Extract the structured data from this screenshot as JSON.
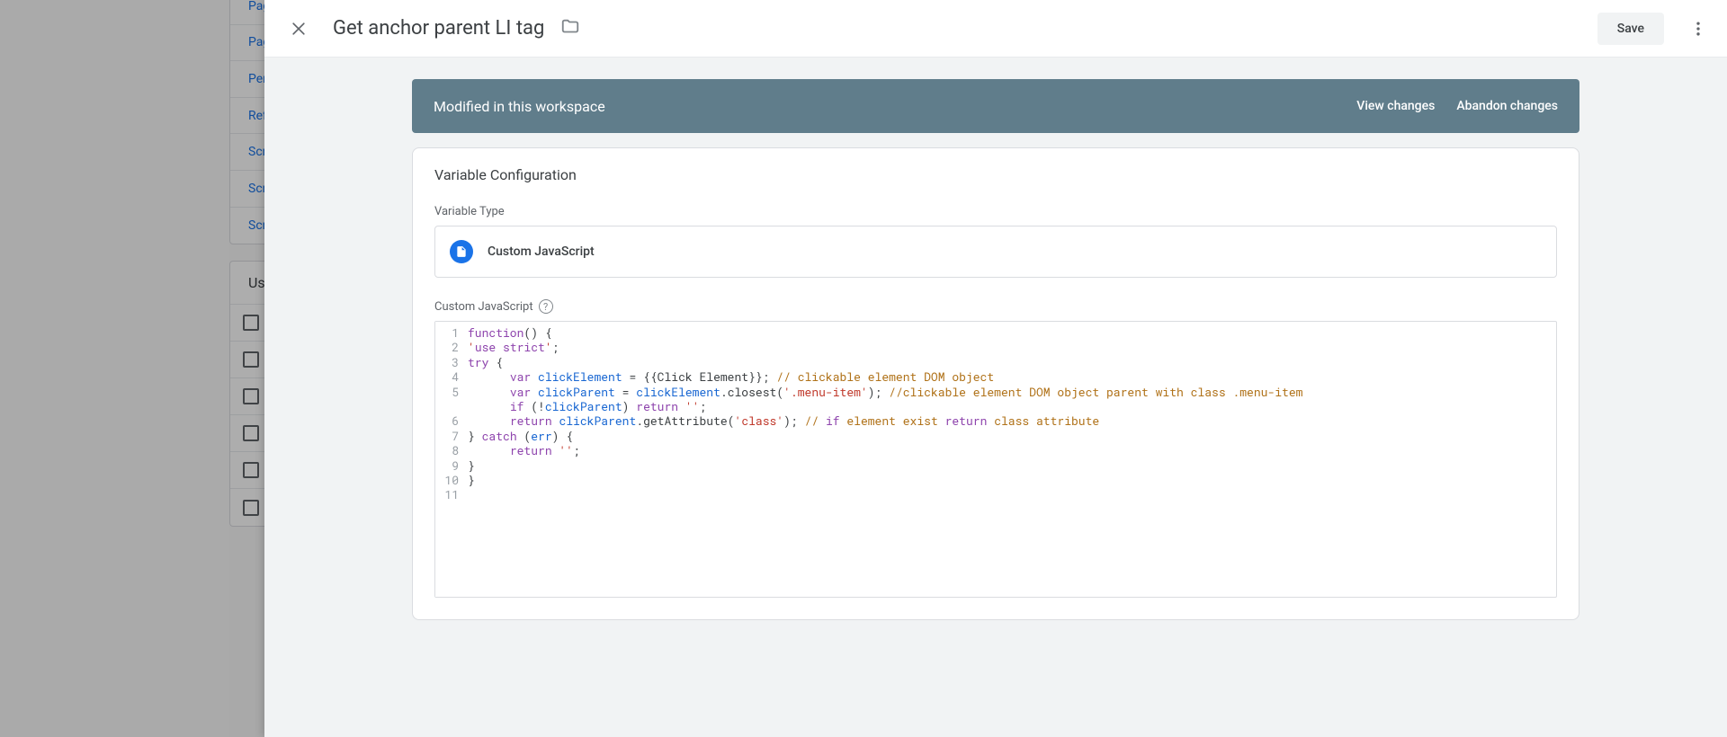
{
  "background": {
    "list_items": [
      "Pag",
      "Pag",
      "Per",
      "Ref",
      "Scr",
      "Scr",
      "Scr"
    ],
    "user_panel_header": "Us"
  },
  "editor_header": {
    "title": "Get anchor parent LI tag",
    "save_label": "Save"
  },
  "banner": {
    "message": "Modified in this workspace",
    "view_changes": "View changes",
    "abandon_changes": "Abandon changes"
  },
  "config": {
    "card_title": "Variable Configuration",
    "type_label": "Variable Type",
    "type_name": "Custom JavaScript",
    "code_label": "Custom JavaScript"
  },
  "code": {
    "lines": [
      "function() {",
      "'use strict';",
      "try {",
      "      var clickElement = {{Click Element}}; // clickable element DOM object",
      "      var clickParent = clickElement.closest('.menu-item'); //clickable element DOM object parent with class .menu-item",
      "      if (!clickParent) return '';",
      "      return clickParent.getAttribute('class'); // if element exist return class attribute",
      "} catch (err) {",
      "      return '';",
      "}",
      "}"
    ],
    "line_numbers": [
      "1",
      "2",
      "3",
      "4",
      "5",
      "6",
      "7",
      "8",
      "9",
      "10",
      "11"
    ]
  }
}
